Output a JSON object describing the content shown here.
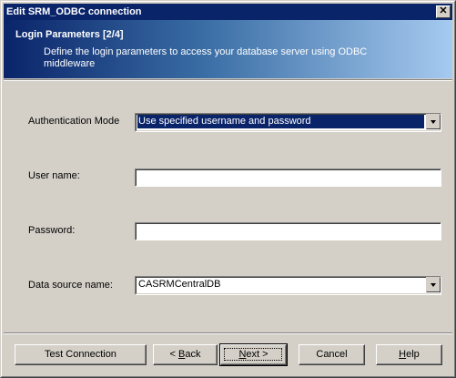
{
  "window": {
    "title": "Edit SRM_ODBC connection",
    "close_glyph": "✕"
  },
  "header": {
    "title": "Login Parameters [2/4]",
    "description": "Define the login parameters to access your database server using ODBC middleware"
  },
  "form": {
    "auth_mode_label": "Authentication Mode",
    "auth_mode_value": "Use specified username and password",
    "username_label": "User name:",
    "username_value": "",
    "password_label": "Password:",
    "password_value": "",
    "dsn_label": "Data source name:",
    "dsn_value": "CASRMCentralDB"
  },
  "buttons": {
    "test_connection": "Test Connection",
    "back_prefix": "< ",
    "back_mnemonic": "B",
    "back_rest": "ack",
    "next_mnemonic": "N",
    "next_rest": "ext >",
    "cancel": "Cancel",
    "help_mnemonic": "H",
    "help_rest": "elp"
  },
  "colors": {
    "titlebar": "#0a246a",
    "dialog_bg": "#d4d0c8",
    "selection": "#0a246a"
  }
}
